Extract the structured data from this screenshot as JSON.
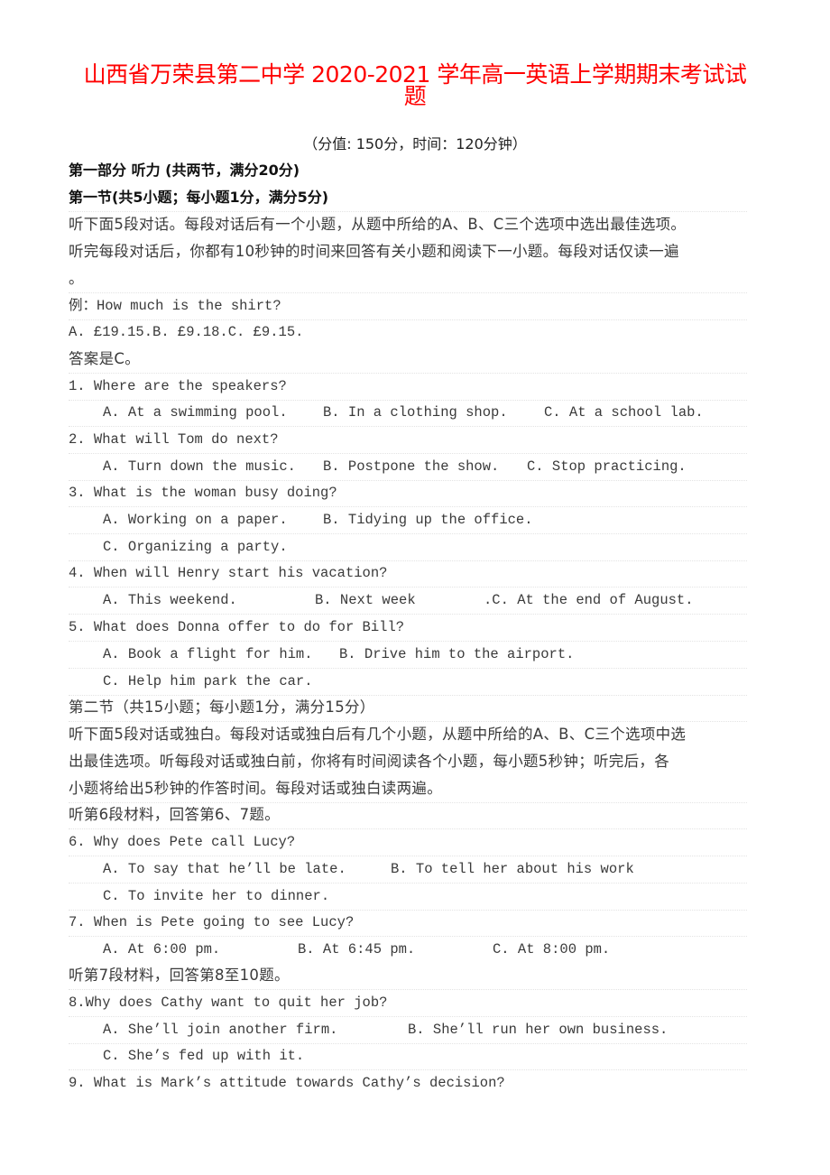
{
  "title": {
    "line1": "山西省万荣县第二中学 2020-2021 学年高一英语上学期期末考试试",
    "line2": "题",
    "color": "#ff0000"
  },
  "meta": "（分值: 150分，时间：120分钟）",
  "part1": {
    "heading": "第一部分 听力 (共两节，满分20分)",
    "section1": {
      "heading": "第一节(共5小题；每小题1分，满分5分)",
      "instructions": [
        "听下面5段对话。每段对话后有一个小题，从题中所给的A、B、C三个选项中选出最佳选项。",
        "听完每段对话后，你都有10秒钟的时间来回答有关小题和阅读下一小题。每段对话仅读一遍",
        "。"
      ],
      "example": {
        "question": "例：How much is the shirt?",
        "options": "A. £19.15.B. £9.18.C. £9.15.",
        "answer": "答案是C。"
      },
      "questions": [
        {
          "q": "1. Where are the speakers?",
          "a": "A. At a swimming pool.",
          "b": "B. In a clothing shop.",
          "c": "C. At a school lab."
        },
        {
          "q": "2. What will Tom do next?",
          "a": "A. Turn down the music.",
          "b": "B. Postpone the show.",
          "c": "C. Stop practicing."
        },
        {
          "q": "3. What is the woman busy doing?",
          "a": "A. Working on a paper.",
          "b": "B. Tidying up the office.",
          "c": "C. Organizing a party."
        },
        {
          "q": "4. When will Henry start his vacation?",
          "a": "A. This weekend.",
          "b": "B. Next week",
          "c": ".C. At the end of August."
        },
        {
          "q": "5. What does Donna offer to do for Bill?",
          "a": "A. Book a flight for him.",
          "b": "B. Drive him to the airport.",
          "c": "C. Help him park the car."
        }
      ]
    },
    "section2": {
      "heading": "第二节（共15小题；每小题1分，满分15分）",
      "instructions": [
        "听下面5段对话或独白。每段对话或独白后有几个小题，从题中所给的A、B、C三个选项中选",
        "出最佳选项。听每段对话或独白前，你将有时间阅读各个小题，每小题5秒钟；听完后，各",
        "小题将给出5秒钟的作答时间。每段对话或独白读两遍。"
      ],
      "material6": "听第6段材料，回答第6、7题。",
      "material7": "听第7段材料，回答第8至10题。",
      "questions": [
        {
          "q": "6. Why does Pete call Lucy?",
          "a": "A. To say that he’ll be late.",
          "b": "B. To tell her about his work",
          "c": "C. To invite her to dinner."
        },
        {
          "q": "7. When is Pete going to see Lucy?",
          "a": "A. At 6:00 pm.",
          "b": "B. At 6:45 pm.",
          "c": "C. At 8:00 pm."
        },
        {
          "q": "8.Why does Cathy want to quit her job?",
          "a": "A. She’ll join another firm.",
          "b": "B. She’ll run her own business.",
          "c": "C. She’s fed up with it."
        },
        {
          "q": "9. What is Mark’s attitude towards Cathy’s decision?"
        }
      ]
    }
  }
}
